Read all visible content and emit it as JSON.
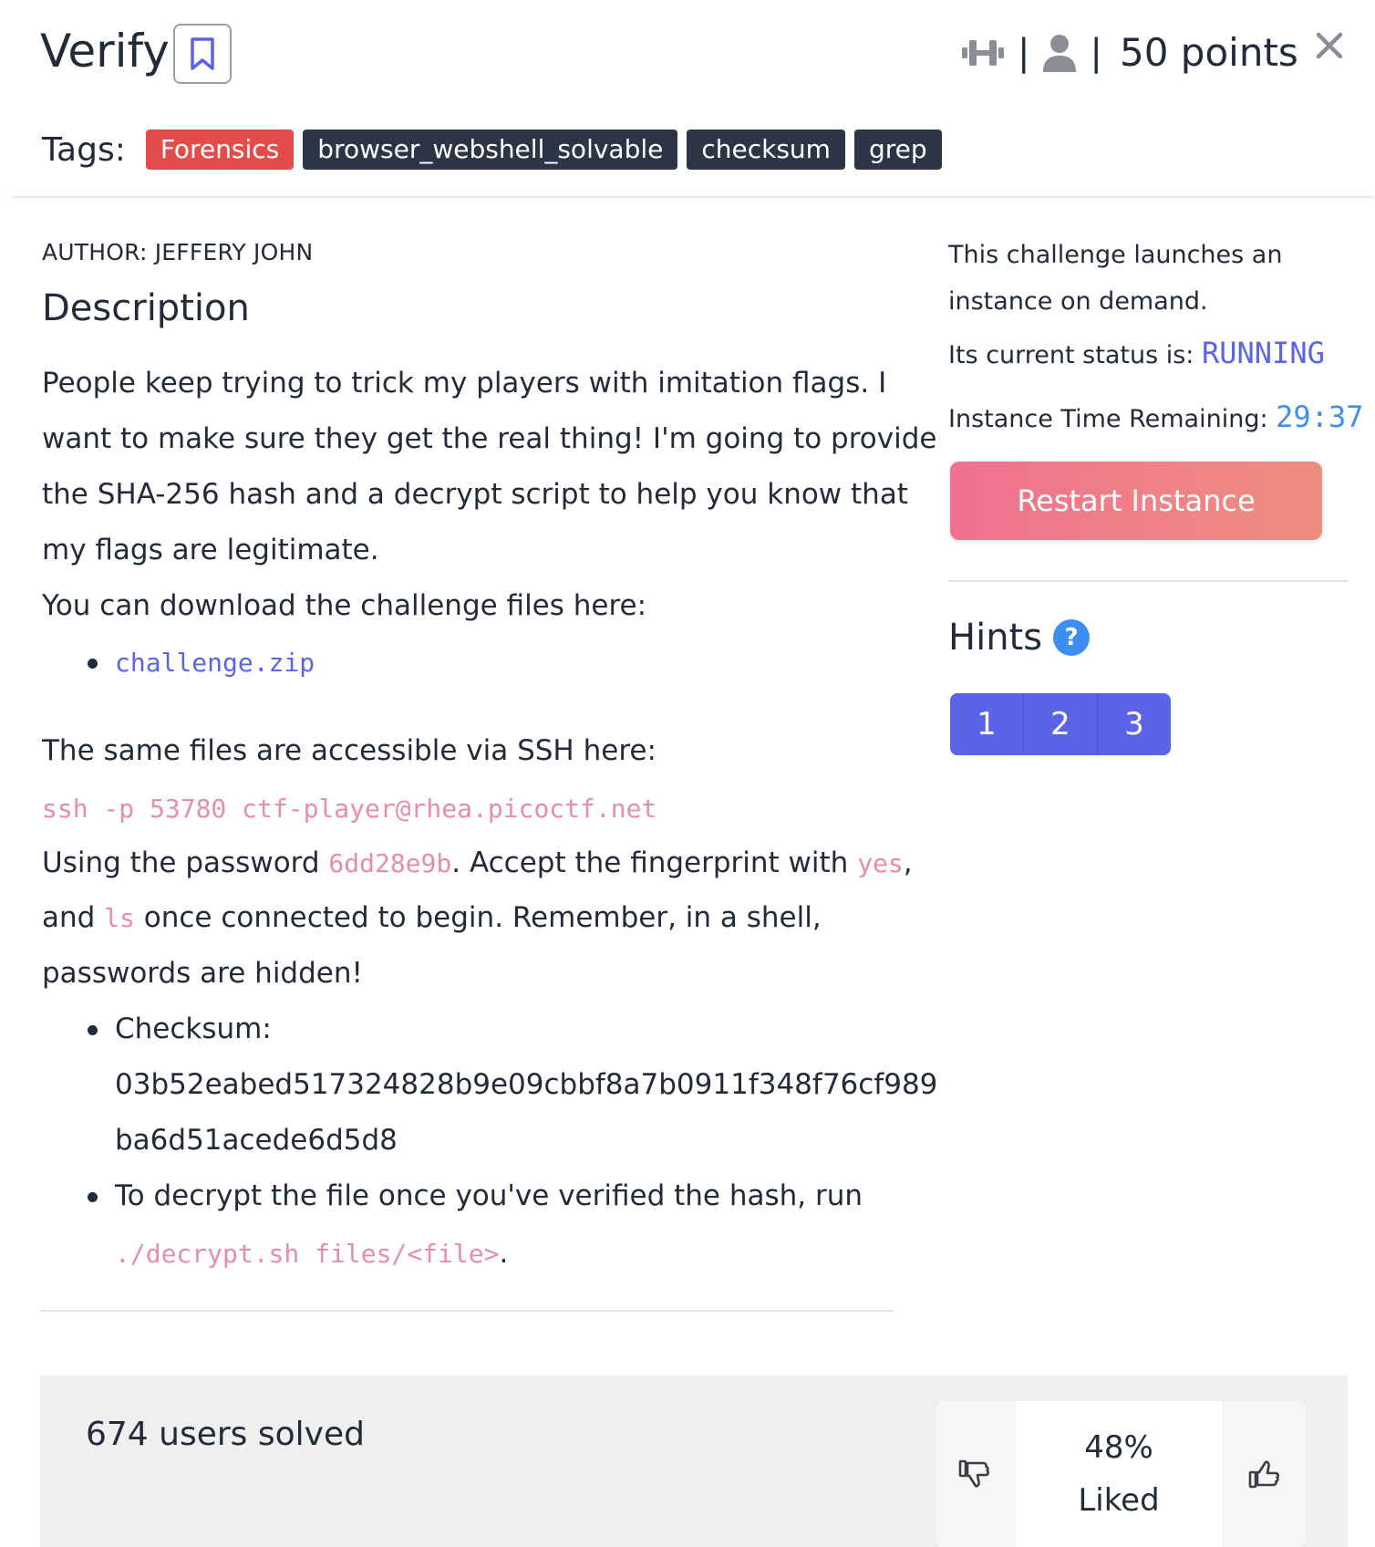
{
  "header": {
    "title": "Verify",
    "sep1": "|",
    "sep2": "|",
    "points": "50 points"
  },
  "tags": {
    "label": "Tags:",
    "items": [
      "Forensics",
      "browser_webshell_solvable",
      "checksum",
      "grep"
    ]
  },
  "content": {
    "author": "AUTHOR: JEFFERY JOHN",
    "heading": "Description",
    "p1_l1": "People keep trying to trick my players with imitation flags. I",
    "p1_l2": "want to make sure they get the real thing! I'm going to provide",
    "p1_l3": "the SHA-256 hash and a decrypt script to help you know that",
    "p1_l4": "my flags are legitimate.",
    "download_text": "You can download the challenge files here:",
    "download_link": "challenge.zip",
    "ssh_text": "The same files are accessible via SSH here:",
    "ssh_command": "ssh -p 53780 ctf-player@rhea.picoctf.net",
    "pw_pre": "Using the password ",
    "pw_code": "6dd28e9b",
    "pw_mid": ". Accept the fingerprint with ",
    "pw_yes": "yes",
    "pw_comma": ",",
    "and_pre": "and ",
    "and_ls": "ls",
    "and_post": " once connected to begin. Remember, in a shell,",
    "hidden_text": "passwords are hidden!",
    "checksum_label": "Checksum:",
    "checksum_l1": "03b52eabed517324828b9e09cbbf8a7b0911f348f76cf989",
    "checksum_l2": "ba6d51acede6d5d8",
    "decrypt_text": "To decrypt the file once you've verified the hash, run",
    "decrypt_code": "./decrypt.sh files/<file>",
    "decrypt_dot": "."
  },
  "instance": {
    "line1": "This challenge launches an",
    "line2": "instance on demand.",
    "status_label": "Its current status is: ",
    "status_value": "RUNNING",
    "time_label": "Instance Time Remaining: ",
    "time_value": "29:37",
    "restart_label": "Restart Instance"
  },
  "hints": {
    "heading": "Hints",
    "help": "?",
    "buttons": [
      "1",
      "2",
      "3"
    ]
  },
  "footer": {
    "solved": "674 users solved",
    "percent": "48%",
    "liked": "Liked"
  }
}
